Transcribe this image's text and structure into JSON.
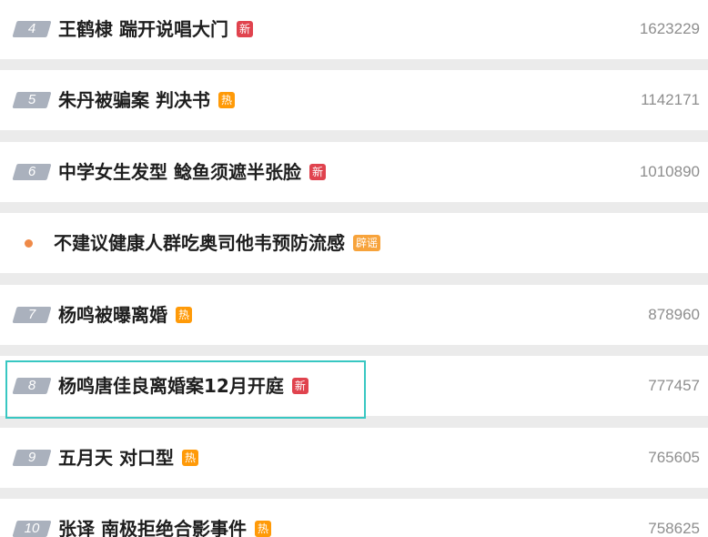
{
  "items": [
    {
      "rank": "4",
      "title": "王鹤棣 踹开说唱大门",
      "tag": "新",
      "count": "1623229"
    },
    {
      "rank": "5",
      "title": "朱丹被骗案 判决书",
      "tag": "热",
      "count": "1142171"
    },
    {
      "rank": "6",
      "title": "中学女生发型 鲶鱼须遮半张脸",
      "tag": "新",
      "count": "1010890"
    },
    {
      "title": "不建议健康人群吃奥司他韦预防流感",
      "tag": "辟谣"
    },
    {
      "rank": "7",
      "title": "杨鸣被曝离婚",
      "tag": "热",
      "count": "878960"
    },
    {
      "rank": "8",
      "title": "杨鸣唐佳良离婚案12月开庭",
      "tag": "新",
      "count": "777457"
    },
    {
      "rank": "9",
      "title": "五月天 对口型",
      "tag": "热",
      "count": "765605"
    },
    {
      "rank": "10",
      "title": "张译 南极拒绝合影事件",
      "tag": "热",
      "count": "758625"
    }
  ],
  "colors": {
    "new_tag": "#e0434e",
    "hot_tag": "#ff9a08",
    "rumor_tag": "#f7a33b",
    "rank_badge": "#aab1bd",
    "highlight_border": "#38c7c2"
  }
}
